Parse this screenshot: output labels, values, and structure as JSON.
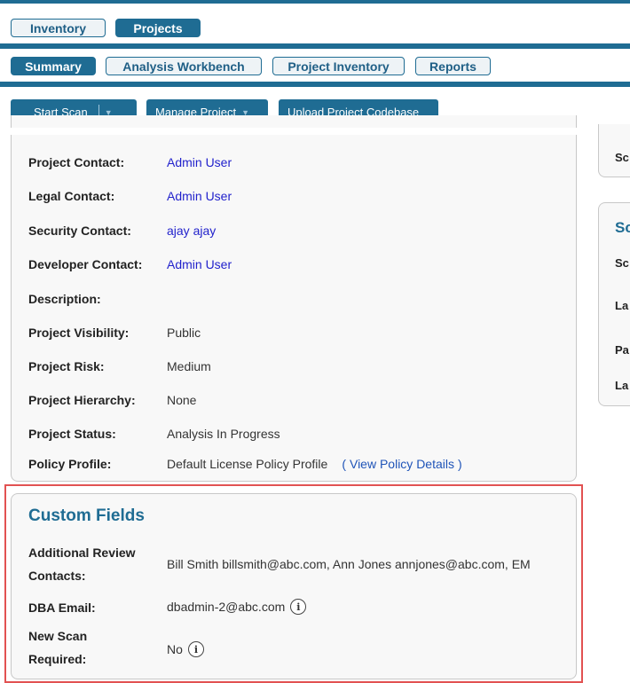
{
  "top_tabs": [
    {
      "label": "Inventory",
      "active": false
    },
    {
      "label": "Projects",
      "active": true
    }
  ],
  "sub_tabs": [
    {
      "label": "Summary",
      "active": true
    },
    {
      "label": "Analysis Workbench",
      "active": false
    },
    {
      "label": "Project Inventory",
      "active": false
    },
    {
      "label": "Reports",
      "active": false
    }
  ],
  "toolbar": {
    "start_scan": "Start Scan",
    "manage_project": "Manage Project",
    "upload_codebase": "Upload Project Codebase"
  },
  "details": [
    {
      "label": "Project Contact:",
      "value": "Admin User"
    },
    {
      "label": "Legal Contact:",
      "value": "Admin User"
    },
    {
      "label": "Security Contact:",
      "value": "ajay ajay"
    },
    {
      "label": "Developer Contact:",
      "value": "Admin User"
    },
    {
      "label": "Description:",
      "value": ""
    },
    {
      "label": "Project Visibility:",
      "value": "Public"
    },
    {
      "label": "Project Risk:",
      "value": "Medium"
    },
    {
      "label": "Project Hierarchy:",
      "value": "None"
    },
    {
      "label": "Project Status:",
      "value": "Analysis In Progress"
    },
    {
      "label": "Policy Profile:",
      "value": "Default License Policy Profile",
      "link_open": "(",
      "link": "View Policy Details",
      "link_close": ")"
    }
  ],
  "side": {
    "s1": "Sc",
    "s2_title": "Sc",
    "s2_rows": [
      "Sc",
      "La",
      "Pa",
      "La"
    ]
  },
  "custom_fields": {
    "title": "Custom Fields",
    "rows": [
      {
        "label_line1": "Additional Review",
        "label_line2": "Contacts:",
        "value": "Bill Smith billsmith@abc.com, Ann Jones annjones@abc.com, EM"
      },
      {
        "label": "DBA Email:",
        "value": "dbadmin-2@abc.com",
        "info": "i"
      },
      {
        "label_line1": "New Scan",
        "label_line2": "Required:",
        "value": "No",
        "info": "i"
      }
    ]
  },
  "colors": {
    "accent": "#1f6c93",
    "link": "#2222cc",
    "highlight": "#e25252"
  }
}
